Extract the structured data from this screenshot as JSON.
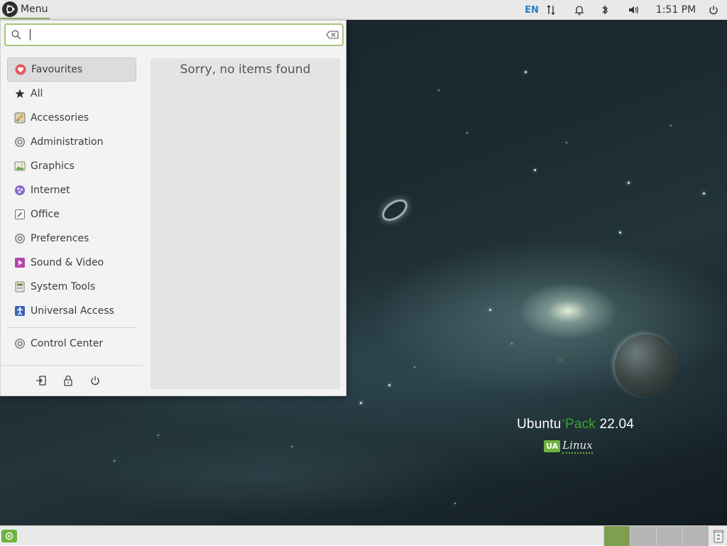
{
  "top_panel": {
    "menu_label": "Menu",
    "keyboard_layout": "EN",
    "clock": "1:51 PM"
  },
  "search": {
    "value": "",
    "placeholder": ""
  },
  "categories": [
    {
      "label": "Favourites",
      "icon": "heart-icon",
      "active": true
    },
    {
      "label": "All",
      "icon": "star-icon"
    },
    {
      "label": "Accessories",
      "icon": "accessories-icon"
    },
    {
      "label": "Administration",
      "icon": "administration-icon"
    },
    {
      "label": "Graphics",
      "icon": "graphics-icon"
    },
    {
      "label": "Internet",
      "icon": "internet-icon"
    },
    {
      "label": "Office",
      "icon": "office-icon"
    },
    {
      "label": "Preferences",
      "icon": "preferences-icon"
    },
    {
      "label": "Sound & Video",
      "icon": "sound-video-icon"
    },
    {
      "label": "System Tools",
      "icon": "system-tools-icon"
    },
    {
      "label": "Universal Access",
      "icon": "universal-access-icon"
    }
  ],
  "control_center": {
    "label": "Control Center",
    "icon": "control-center-icon"
  },
  "apps": {
    "empty_message": "Sorry, no items found"
  },
  "wallpaper": {
    "brand_main": "Ubuntu",
    "brand_accent": "Pack",
    "brand_version": " 22.04",
    "logo_badge": "UA",
    "logo_word": "Linux"
  },
  "colors": {
    "accent": "#8bb158",
    "active_workspace": "#7f9f50",
    "favourites_icon": "#e05a5a"
  }
}
